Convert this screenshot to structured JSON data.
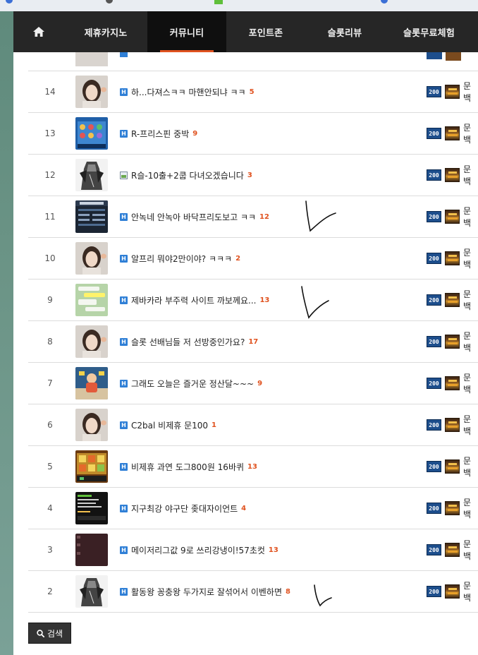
{
  "nav": {
    "home_icon": "home-icon",
    "items": [
      {
        "label": "제휴카지노"
      },
      {
        "label": "커뮤니티",
        "active": true
      },
      {
        "label": "포인트존"
      },
      {
        "label": "슬롯리뷰"
      },
      {
        "label": "슬롯무료체험"
      }
    ]
  },
  "posts": [
    {
      "num": "14",
      "thumb": "portrait",
      "type": "H",
      "title": "하...다져스ㅋㅋ 마핸안되냐 ㅋㅋ",
      "comments": "5",
      "level": "200",
      "writer": "문백"
    },
    {
      "num": "13",
      "thumb": "slot-game",
      "type": "H",
      "title": "R-프리스핀 중박",
      "comments": "9",
      "level": "200",
      "writer": "문백"
    },
    {
      "num": "12",
      "thumb": "warrior",
      "type": "image",
      "title": "R슬-10출+2쿱 다녀오겠습니다",
      "comments": "3",
      "level": "200",
      "writer": "문백"
    },
    {
      "num": "11",
      "thumb": "deposit-screen",
      "type": "H",
      "title": "안녹네 안녹아 바닥프리도보고 ㅋㅋ",
      "comments": "12",
      "level": "200",
      "writer": "문백"
    },
    {
      "num": "10",
      "thumb": "portrait",
      "type": "H",
      "title": "알프리 뭐야2만이야? ㅋㅋㅋ",
      "comments": "2",
      "level": "200",
      "writer": "문백"
    },
    {
      "num": "9",
      "thumb": "chat-screen",
      "type": "H",
      "title": "제바카라 부주력 사이트 까보께요...",
      "comments": "13",
      "level": "200",
      "writer": "문백"
    },
    {
      "num": "8",
      "thumb": "portrait",
      "type": "H",
      "title": "슬롯 선배님들 저 선방중인가요?",
      "comments": "17",
      "level": "200",
      "writer": "문백"
    },
    {
      "num": "7",
      "thumb": "cartoon",
      "type": "H",
      "title": "그래도 오늘은 즐거운 정산달~~~",
      "comments": "9",
      "level": "200",
      "writer": "문백"
    },
    {
      "num": "6",
      "thumb": "portrait",
      "type": "H",
      "title": "C2bal 비제휴 문100",
      "comments": "1",
      "level": "200",
      "writer": "문백"
    },
    {
      "num": "5",
      "thumb": "slot-gold",
      "type": "H",
      "title": "비제휴 과연 도그800원 16바퀴",
      "comments": "13",
      "level": "200",
      "writer": "문백"
    },
    {
      "num": "4",
      "thumb": "dark-screen",
      "type": "H",
      "title": "지구최강 야구단 좆대자이언트",
      "comments": "4",
      "level": "200",
      "writer": "문백"
    },
    {
      "num": "3",
      "thumb": "maroon",
      "type": "H",
      "title": "메이저리그값 9로 쓰리강냉이!57초컷",
      "comments": "13",
      "level": "200",
      "writer": "문백"
    },
    {
      "num": "2",
      "thumb": "warrior",
      "type": "H",
      "title": "활동왕 꽁충왕 두가지로 잘섞어서 이벤하면",
      "comments": "8",
      "level": "200",
      "writer": "문백"
    }
  ],
  "search": {
    "icon": "search-icon",
    "label": "검색"
  },
  "colors": {
    "accent": "#e0521f",
    "navbar": "#262626",
    "badge_h": "#2f7fd6",
    "level_badge": "#1d4e8c"
  }
}
